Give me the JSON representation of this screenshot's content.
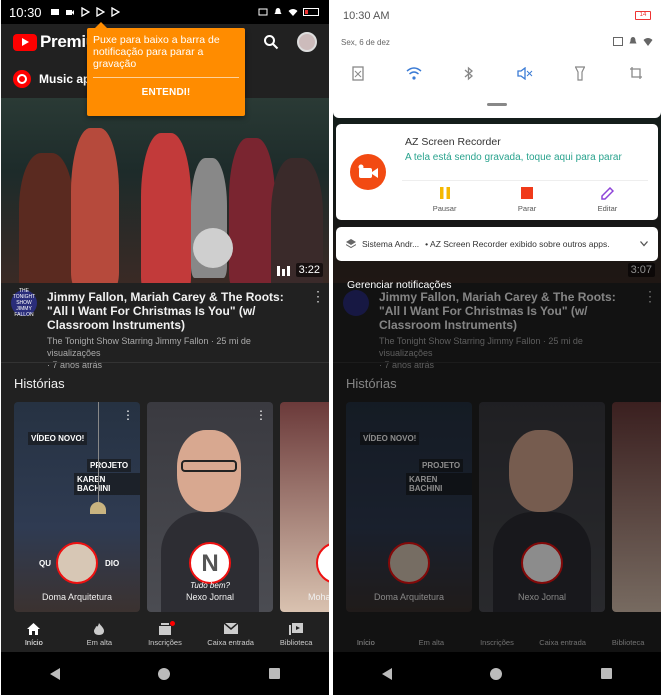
{
  "left": {
    "status": {
      "time": "10:30"
    },
    "app": {
      "name": "Premium"
    },
    "chip": {
      "label": "Music app"
    },
    "tooltip": {
      "text": "Puxe para baixo a barra de notificação para parar a gravação",
      "button": "ENTENDI!"
    },
    "video": {
      "duration": "3:22",
      "title": "Jimmy Fallon, Mariah Carey & The Roots: \"All I Want For Christmas Is You\" (w/ Classroom Instruments)",
      "channel_line": "The Tonight Show Starring Jimmy Fallon · 25 mi de visualizações",
      "age": "· 7 anos atrás",
      "channel_avatar_text": "THE TONIGHT SHOW JIMMY FALLON"
    },
    "stories": {
      "heading": "Histórias",
      "items": [
        {
          "name": "Doma Arquitetura",
          "tag1": "VÍDEO NOVO!",
          "tag2": "PROJETO",
          "tag3": "KAREN BACHINI",
          "tag4": "QU",
          "tag5": "DIO"
        },
        {
          "name": "Nexo Jornal",
          "caption": "Tudo bem?"
        },
        {
          "name": "Moha"
        }
      ]
    },
    "nav": [
      {
        "label": "Início",
        "icon": "home-icon"
      },
      {
        "label": "Em alta",
        "icon": "flame-icon"
      },
      {
        "label": "Inscrições",
        "icon": "subscriptions-icon"
      },
      {
        "label": "Caixa entrada",
        "icon": "mail-icon"
      },
      {
        "label": "Biblioteca",
        "icon": "library-icon"
      }
    ]
  },
  "right": {
    "shade": {
      "time": "10:30 AM",
      "battery": "14",
      "date": "Sex, 6 de dez"
    },
    "recorder": {
      "app": "AZ Screen Recorder",
      "message": "A tela está sendo gravada, toque aqui para parar",
      "actions": [
        {
          "label": "Pausar",
          "color": "#f5b800"
        },
        {
          "label": "Parar",
          "color": "#f03a1a"
        },
        {
          "label": "Editar",
          "color": "#8e44d8"
        }
      ]
    },
    "system_notif": {
      "source": "Sistema Andr...",
      "text": "• AZ Screen Recorder exibido sobre outros apps."
    },
    "manage": "Gerenciar notificações",
    "duration": "3:07"
  },
  "colors": {
    "accent": "#ff8c00",
    "youtube_red": "#ff0000",
    "recorder": "#f24a12",
    "teal_text": "#2aa38e"
  }
}
